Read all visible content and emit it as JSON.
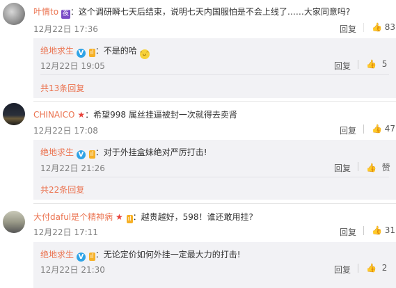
{
  "comments": [
    {
      "username": "叶情to",
      "badge": "夜",
      "text": "：这个调研瞬七天后结束，说明七天内国服怕是不会上线了……大家同意吗?",
      "time": "12月22日 17:36",
      "reply_label": "回复",
      "likes": "83",
      "reply": {
        "username": "绝地求生",
        "verified": "V",
        "level": "ıl",
        "text": "：不是的哈",
        "time": "12月22日 19:05",
        "reply_label": "回复",
        "likes": "5"
      },
      "more_replies": "共13条回复"
    },
    {
      "username": "CHINAICO",
      "text": "：希望998 属丝挂逼被封一次就得去卖肾",
      "time": "12月22日 17:08",
      "reply_label": "回复",
      "likes": "47",
      "reply": {
        "username": "绝地求生",
        "verified": "V",
        "level": "ıl",
        "text": "：对于外挂盒妹绝对严厉打击!",
        "time": "12月22日 21:26",
        "reply_label": "回复",
        "likes": "赞"
      },
      "more_replies": "共22条回复"
    },
    {
      "username": "大付daful是个精神病",
      "level": "ıl",
      "text": "：越贵越好，598！谁还敢用挂?",
      "time": "12月22日 17:11",
      "reply_label": "回复",
      "likes": "31",
      "reply": {
        "username": "绝地求生",
        "verified": "V",
        "level": "ıl",
        "text": "：无论定价如何外挂一定最大力的打击!",
        "time": "12月22日 21:30",
        "reply_label": "回复",
        "likes": "2"
      }
    }
  ],
  "colors": {
    "username": "#eb7350",
    "reply_bg": "#f2f2f5",
    "verified": "#2fa3e6"
  },
  "icons": {
    "like": "thumbs-up-icon",
    "verified": "verified-v-icon",
    "star": "star-icon",
    "emoji": "smile-emoji-icon"
  }
}
